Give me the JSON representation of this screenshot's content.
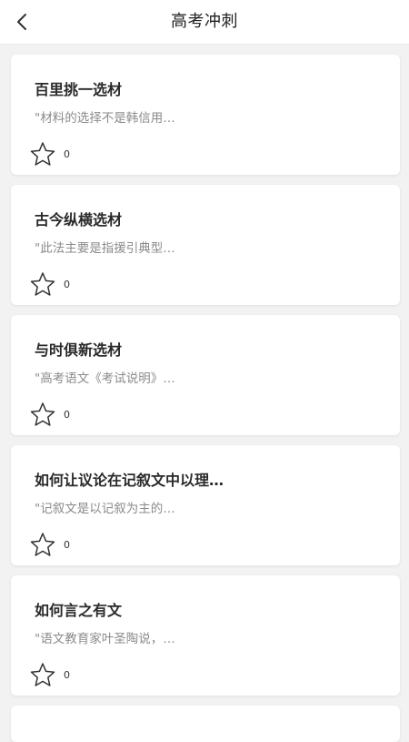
{
  "header": {
    "title": "高考冲刺"
  },
  "cards": [
    {
      "title": "百里挑一选材",
      "snippet": "\"材料的选择不是韩信用…",
      "likes": "0"
    },
    {
      "title": "古今纵横选材",
      "snippet": "\"此法主要是指援引典型…",
      "likes": "0"
    },
    {
      "title": "与时俱新选材",
      "snippet": "\"高考语文《考试说明》…",
      "likes": "0"
    },
    {
      "title": "如何让议论在记叙文中以理…",
      "snippet": "\"记叙文是以记叙为主的…",
      "likes": "0"
    },
    {
      "title": "如何言之有文",
      "snippet": "\"语文教育家叶圣陶说，…",
      "likes": "0"
    }
  ],
  "icons": {
    "back": "chevron-left-icon",
    "like": "star-outline-icon"
  }
}
